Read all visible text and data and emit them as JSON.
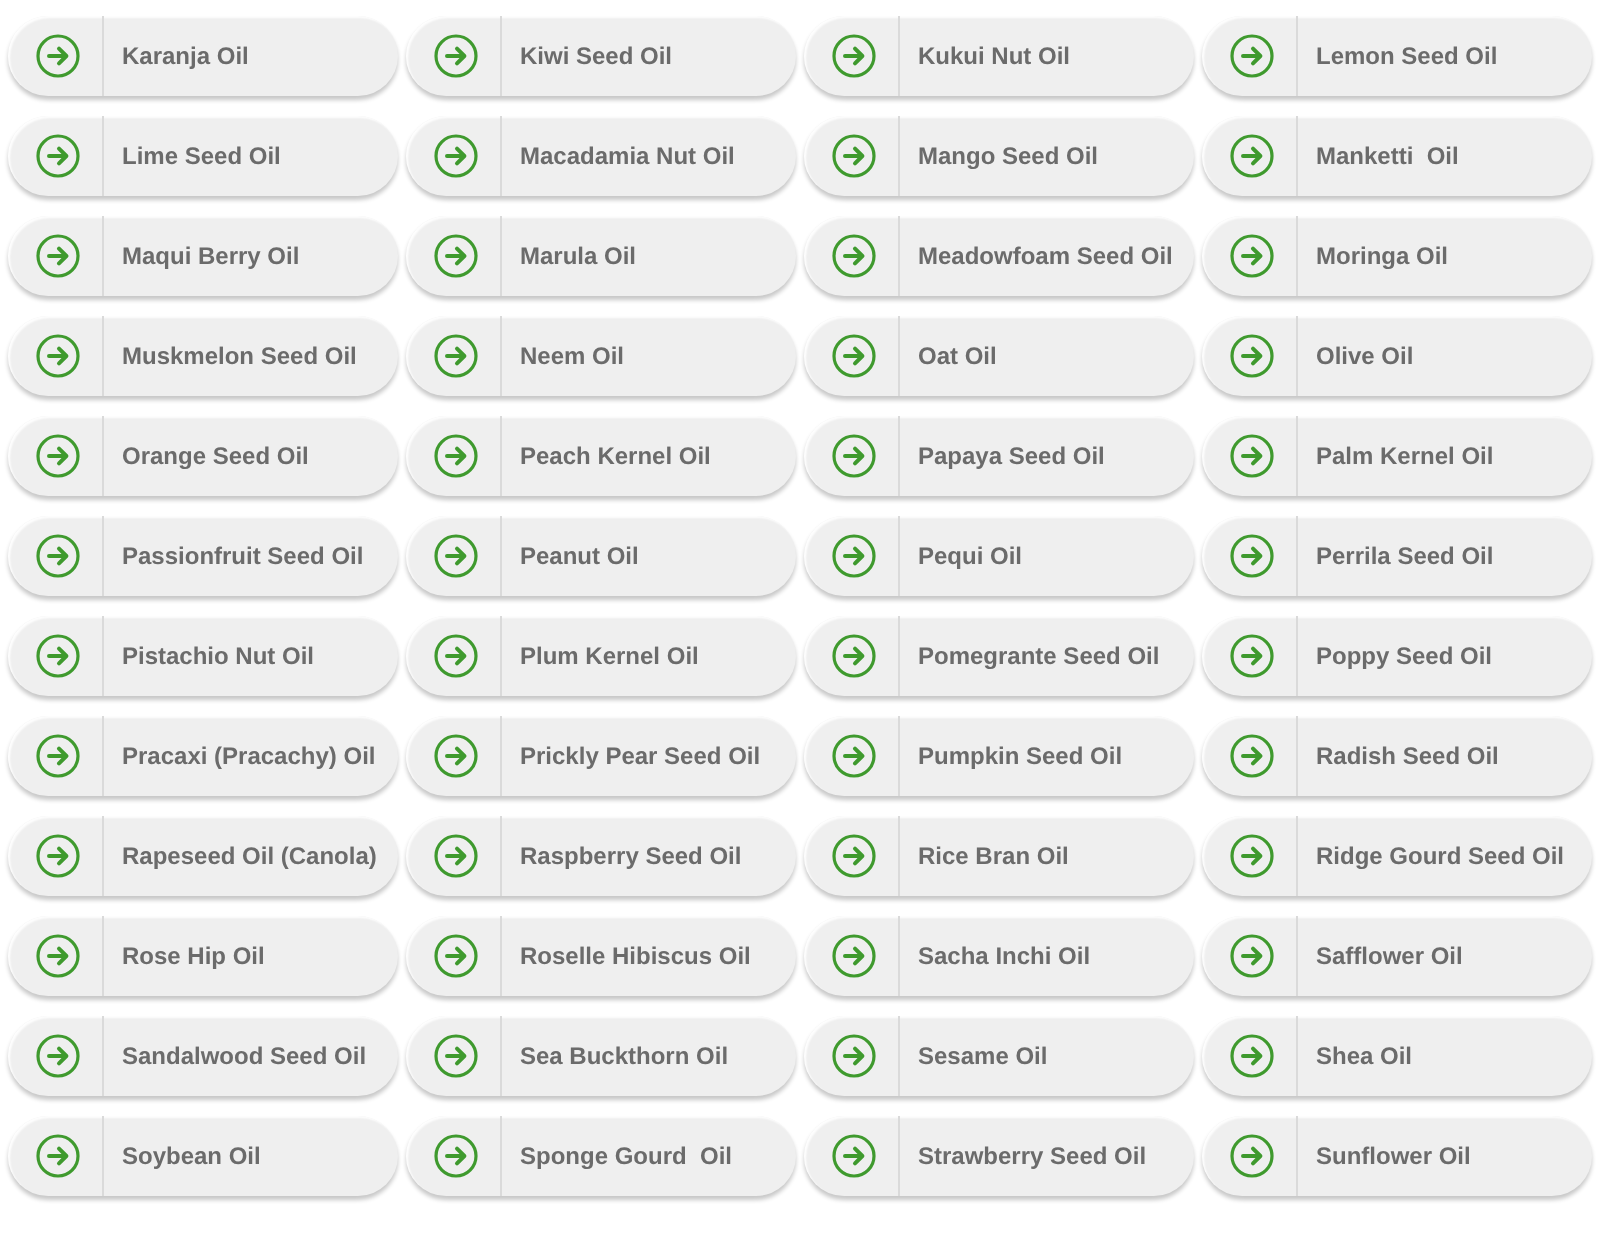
{
  "items": [
    "Karanja Oil",
    "Kiwi Seed Oil",
    "Kukui Nut Oil",
    "Lemon Seed Oil",
    "Lime Seed Oil",
    "Macadamia Nut Oil",
    "Mango Seed Oil",
    "Manketti  Oil",
    "Maqui Berry Oil",
    "Marula Oil",
    "Meadowfoam Seed Oil",
    "Moringa Oil",
    "Muskmelon Seed Oil",
    "Neem Oil",
    "Oat Oil",
    "Olive Oil",
    "Orange Seed Oil",
    "Peach Kernel Oil",
    "Papaya Seed Oil",
    "Palm Kernel Oil",
    "Passionfruit Seed Oil",
    "Peanut Oil",
    "Pequi Oil",
    "Perrila Seed Oil",
    "Pistachio Nut Oil",
    "Plum Kernel Oil",
    "Pomegrante Seed Oil",
    "Poppy Seed Oil",
    "Pracaxi (Pracachy) Oil",
    "Prickly Pear Seed Oil",
    "Pumpkin Seed Oil",
    "Radish Seed Oil",
    "Rapeseed Oil (Canola)",
    "Raspberry Seed Oil",
    "Rice Bran Oil",
    "Ridge Gourd Seed Oil",
    "Rose Hip Oil",
    "Roselle Hibiscus Oil",
    "Sacha Inchi Oil",
    "Safflower Oil",
    "Sandalwood Seed Oil",
    "Sea Buckthorn Oil",
    "Sesame Oil",
    "Shea Oil",
    "Soybean Oil",
    "Sponge Gourd  Oil",
    "Strawberry Seed Oil",
    "Sunflower Oil"
  ]
}
